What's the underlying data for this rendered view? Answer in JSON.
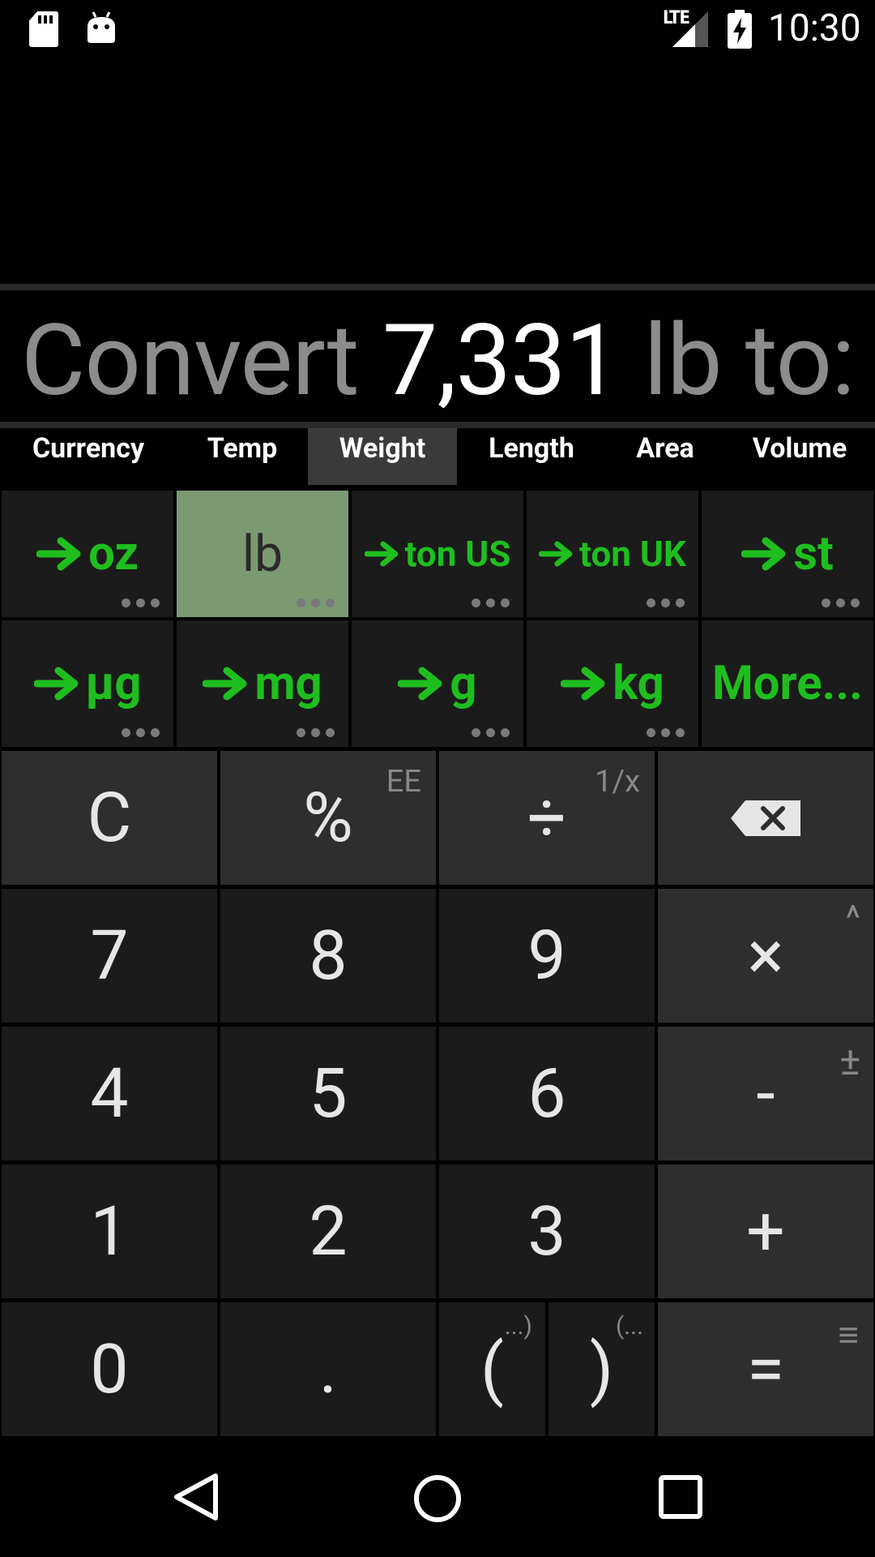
{
  "status_bar": {
    "network": "LTE",
    "time": "10:30"
  },
  "display": {
    "prefix": "Convert",
    "value": "7,331",
    "suffix": "lb to:"
  },
  "tabs": [
    {
      "label": "Currency",
      "active": false
    },
    {
      "label": "Temp",
      "active": false
    },
    {
      "label": "Weight",
      "active": true
    },
    {
      "label": "Length",
      "active": false
    },
    {
      "label": "Area",
      "active": false
    },
    {
      "label": "Volume",
      "active": false
    }
  ],
  "units": [
    {
      "label": "oz",
      "arrow": true,
      "selected": false,
      "more_dots": true
    },
    {
      "label": "lb",
      "arrow": false,
      "selected": true,
      "more_dots": true
    },
    {
      "label": "ton US",
      "arrow": true,
      "selected": false,
      "more_dots": true
    },
    {
      "label": "ton UK",
      "arrow": true,
      "selected": false,
      "more_dots": true
    },
    {
      "label": "st",
      "arrow": true,
      "selected": false,
      "more_dots": true
    },
    {
      "label": "µg",
      "arrow": true,
      "selected": false,
      "more_dots": true
    },
    {
      "label": "mg",
      "arrow": true,
      "selected": false,
      "more_dots": true
    },
    {
      "label": "g",
      "arrow": true,
      "selected": false,
      "more_dots": true
    },
    {
      "label": "kg",
      "arrow": true,
      "selected": false,
      "more_dots": true
    },
    {
      "label": "More...",
      "arrow": false,
      "selected": false,
      "more_dots": false
    }
  ],
  "keypad": {
    "clear": "C",
    "percent": "%",
    "percent_alt": "EE",
    "divide": "÷",
    "divide_alt": "1/x",
    "seven": "7",
    "eight": "8",
    "nine": "9",
    "multiply": "×",
    "multiply_alt": "^",
    "four": "4",
    "five": "5",
    "six": "6",
    "minus": "-",
    "minus_alt": "±",
    "one": "1",
    "two": "2",
    "three": "3",
    "plus": "+",
    "zero": "0",
    "decimal": ".",
    "open_paren": "(",
    "open_paren_alt": "...)",
    "close_paren": ")",
    "close_paren_alt": "(...",
    "equals": "=",
    "equals_alt": "≡"
  },
  "colors": {
    "accent_green": "#1fbe1f",
    "selected_unit_bg": "#7c9a72",
    "key_bg": "#1b1b1b",
    "function_key_bg": "#2e2e2e"
  },
  "icons": [
    "sd-card-icon",
    "android-debug-icon",
    "signal-icon",
    "battery-charging-icon",
    "backspace-icon",
    "back-icon",
    "home-icon",
    "recents-icon"
  ]
}
